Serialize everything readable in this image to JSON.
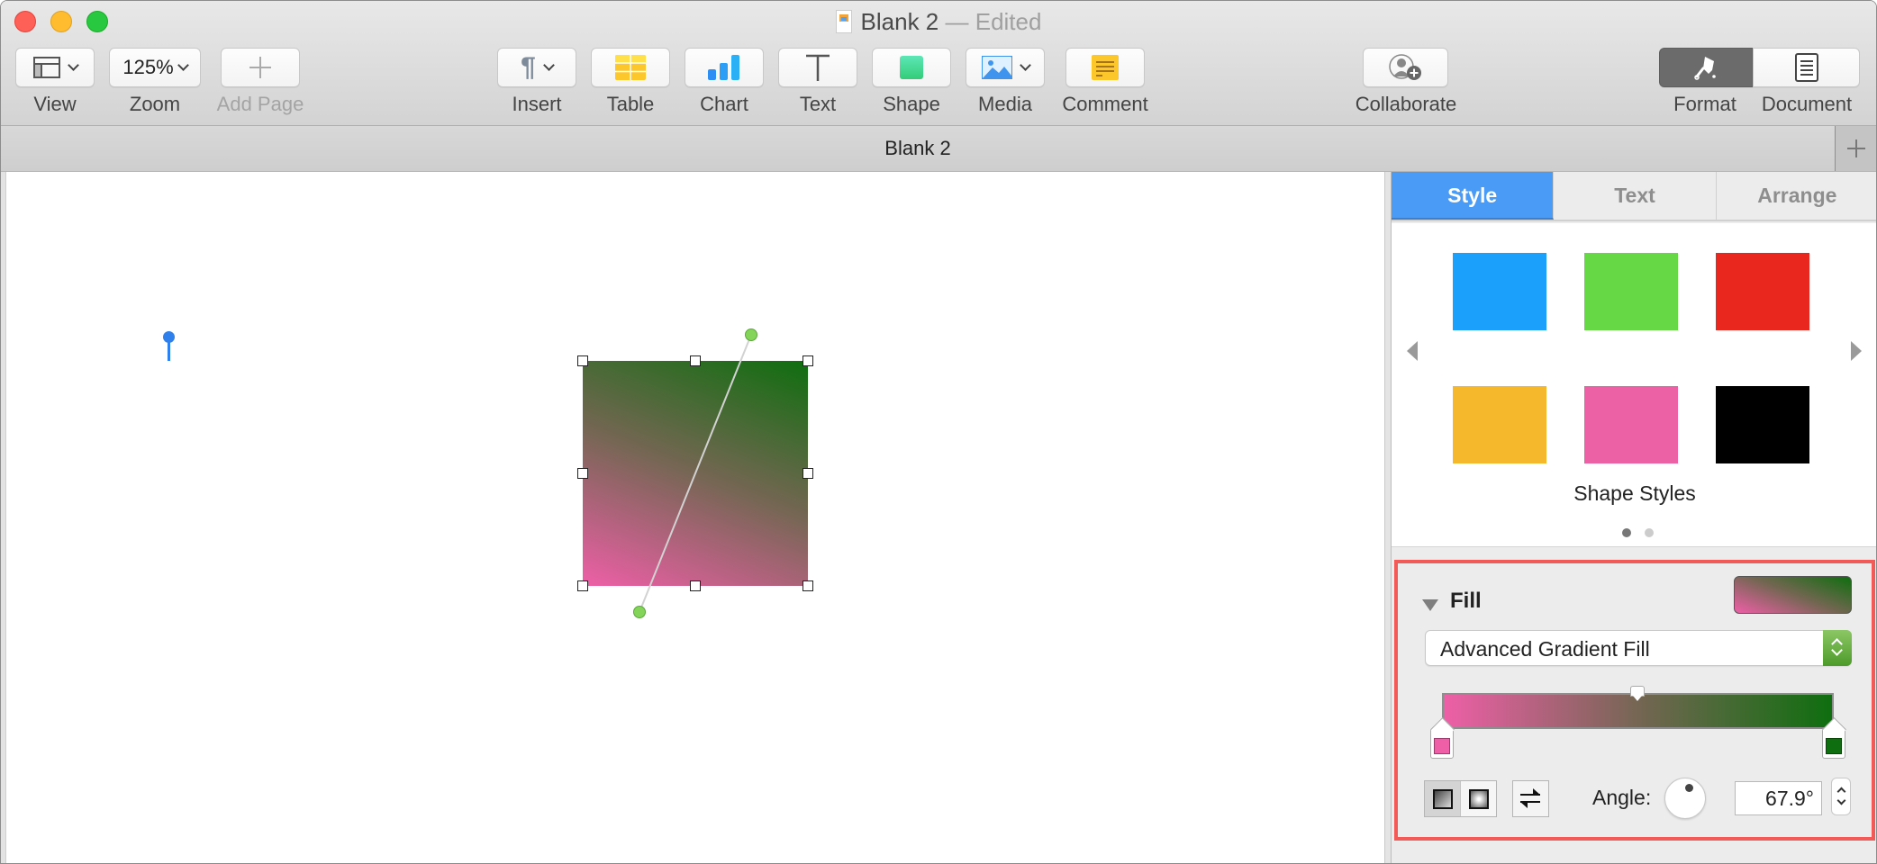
{
  "window": {
    "title": "Blank 2",
    "title_suffix": " — Edited",
    "traffic_lights": [
      "close",
      "minimize",
      "maximize"
    ]
  },
  "toolbar": {
    "view_label": "View",
    "zoom_value": "125%",
    "zoom_label": "Zoom",
    "add_page_label": "Add Page",
    "insert_label": "Insert",
    "table_label": "Table",
    "chart_label": "Chart",
    "text_label": "Text",
    "shape_label": "Shape",
    "media_label": "Media",
    "comment_label": "Comment",
    "collaborate_label": "Collaborate",
    "format_label": "Format",
    "document_label": "Document",
    "active_panel": "Format"
  },
  "tabbar": {
    "tabs": [
      {
        "label": "Blank 2",
        "active": true
      }
    ],
    "add_tab_icon": "plus-icon"
  },
  "canvas": {
    "selected_shape": {
      "type": "rectangle",
      "fill": "advanced-gradient",
      "gradient_start": "#ee5fa7",
      "gradient_mid": "#756653",
      "gradient_end": "#0f6e0f"
    }
  },
  "sidebar": {
    "tabs": [
      {
        "label": "Style",
        "active": true
      },
      {
        "label": "Text",
        "active": false
      },
      {
        "label": "Arrange",
        "active": false
      }
    ],
    "shape_styles": {
      "label": "Shape Styles",
      "swatches": [
        "#1ba1fb",
        "#66d745",
        "#ea271f",
        "#f5b82c",
        "#ec61a6",
        "#000000"
      ],
      "page": 1,
      "page_count": 2
    },
    "fill": {
      "title": "Fill",
      "expanded": true,
      "fill_type": "Advanced Gradient Fill",
      "stops": [
        {
          "position": 0,
          "color": "#ee5fa7"
        },
        {
          "position": 1,
          "color": "#0f6e0f"
        }
      ],
      "midpoint": 0.5,
      "gradient_type": "linear",
      "angle_label": "Angle:",
      "angle_value": "67.9°"
    }
  }
}
